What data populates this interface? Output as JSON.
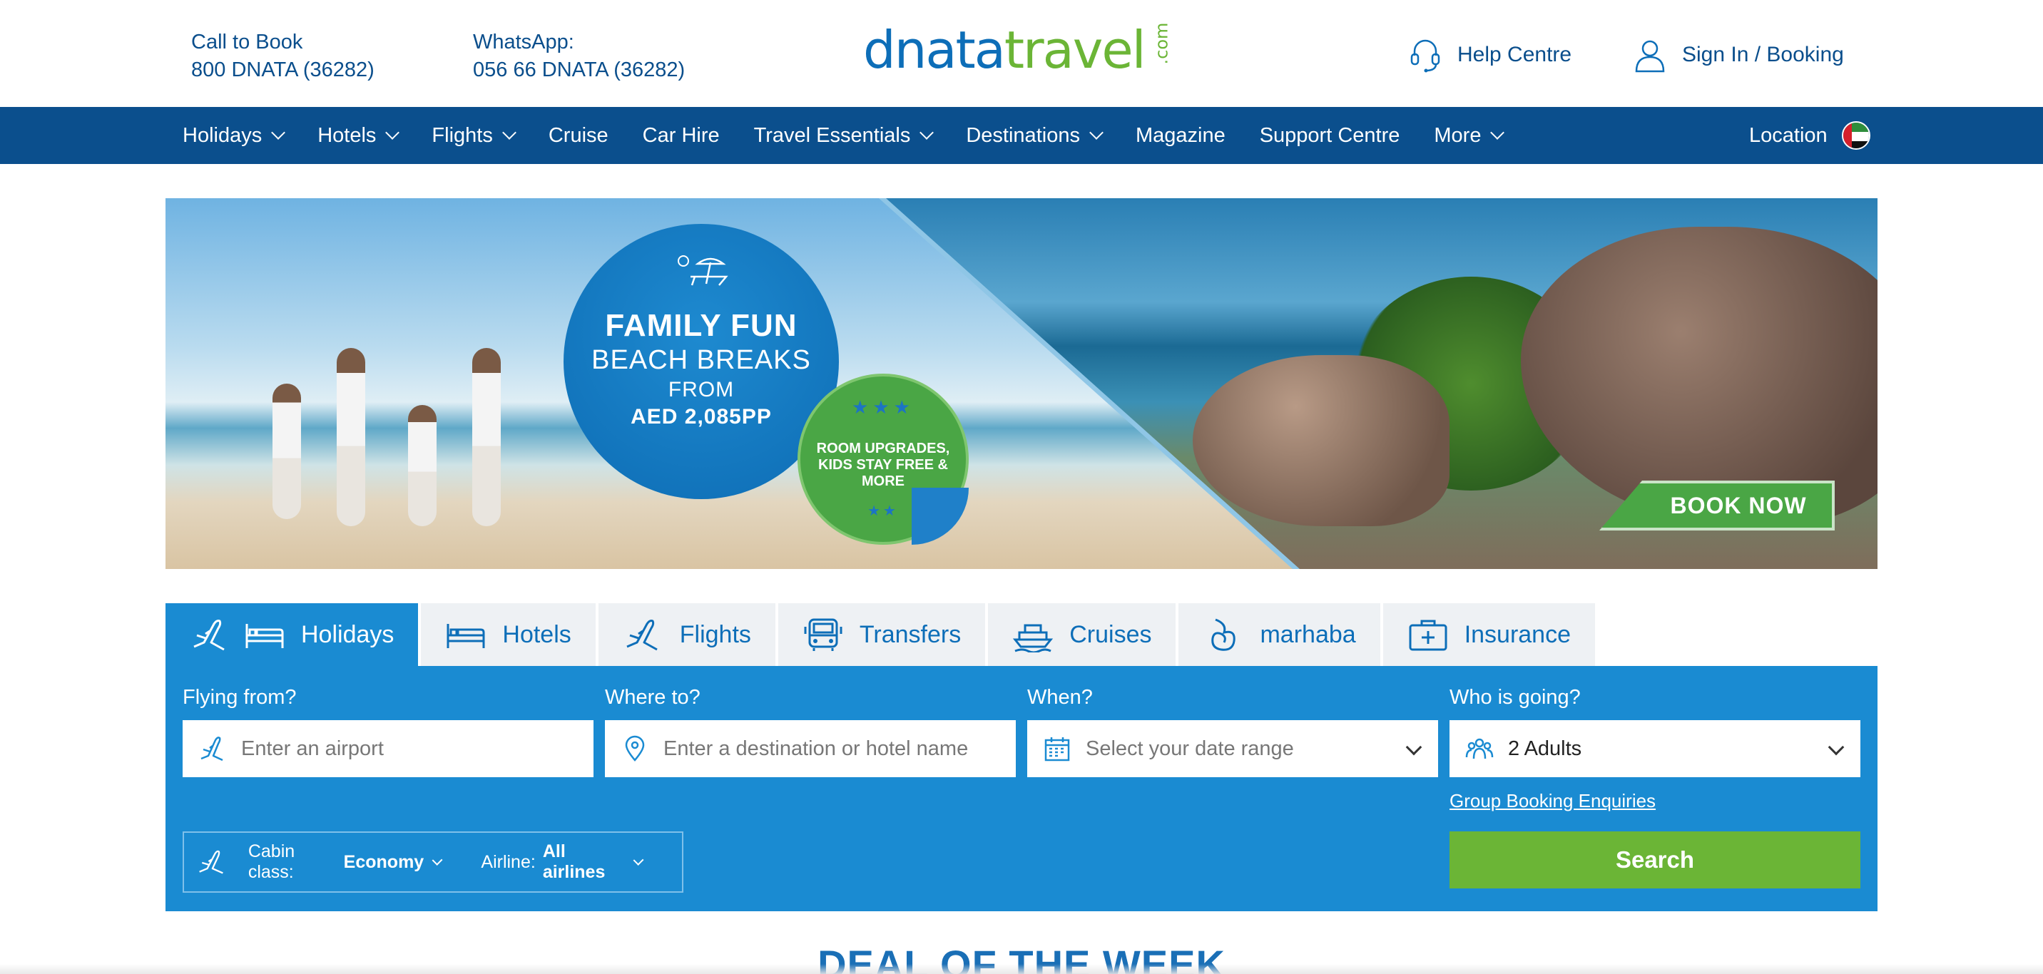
{
  "header": {
    "call_label": "Call to Book",
    "call_number": "800 DNATA (36282)",
    "whatsapp_label": "WhatsApp:",
    "whatsapp_number": "056 66 DNATA (36282)",
    "logo_part1": "dnata",
    "logo_part2": "travel",
    "logo_part3": ".com",
    "help": "Help Centre",
    "sign_in": "Sign In / Booking"
  },
  "nav": {
    "items": [
      {
        "label": "Holidays",
        "dropdown": true
      },
      {
        "label": "Hotels",
        "dropdown": true
      },
      {
        "label": "Flights",
        "dropdown": true
      },
      {
        "label": "Cruise",
        "dropdown": false
      },
      {
        "label": "Car Hire",
        "dropdown": false
      },
      {
        "label": "Travel Essentials",
        "dropdown": true
      },
      {
        "label": "Destinations",
        "dropdown": true
      },
      {
        "label": "Magazine",
        "dropdown": false
      },
      {
        "label": "Support Centre",
        "dropdown": false
      },
      {
        "label": "More",
        "dropdown": true
      }
    ],
    "location": "Location",
    "flag_icon": "uae-flag-icon"
  },
  "banner": {
    "title1": "FAMILY FUN",
    "title2": "BEACH BREAKS",
    "from": "FROM",
    "price": "AED 2,085PP",
    "badge": "ROOM UPGRADES, KIDS STAY FREE & MORE",
    "cta": "BOOK NOW"
  },
  "tabs": [
    {
      "label": "Holidays",
      "icon": "plane-bed-icon",
      "active": true
    },
    {
      "label": "Hotels",
      "icon": "bed-icon",
      "active": false
    },
    {
      "label": "Flights",
      "icon": "plane-icon",
      "active": false
    },
    {
      "label": "Transfers",
      "icon": "bus-icon",
      "active": false
    },
    {
      "label": "Cruises",
      "icon": "ship-icon",
      "active": false
    },
    {
      "label": "marhaba",
      "icon": "marhaba-icon",
      "active": false
    },
    {
      "label": "Insurance",
      "icon": "medical-kit-icon",
      "active": false
    }
  ],
  "search": {
    "from_label": "Flying from?",
    "from_placeholder": "Enter an airport",
    "to_label": "Where to?",
    "to_placeholder": "Enter a destination or hotel name",
    "when_label": "When?",
    "when_placeholder": "Select your date range",
    "who_label": "Who is going?",
    "who_value": "2 Adults",
    "group_link": "Group Booking Enquiries",
    "cabin_label": "Cabin class:",
    "cabin_value": "Economy",
    "airline_label": "Airline:",
    "airline_value": "All airlines",
    "search_button": "Search"
  },
  "deal_title": "DEAL OF THE WEEK",
  "colors": {
    "brand_blue": "#0b4f8d",
    "panel_blue": "#1a8bd2",
    "brand_green": "#6bb536"
  }
}
